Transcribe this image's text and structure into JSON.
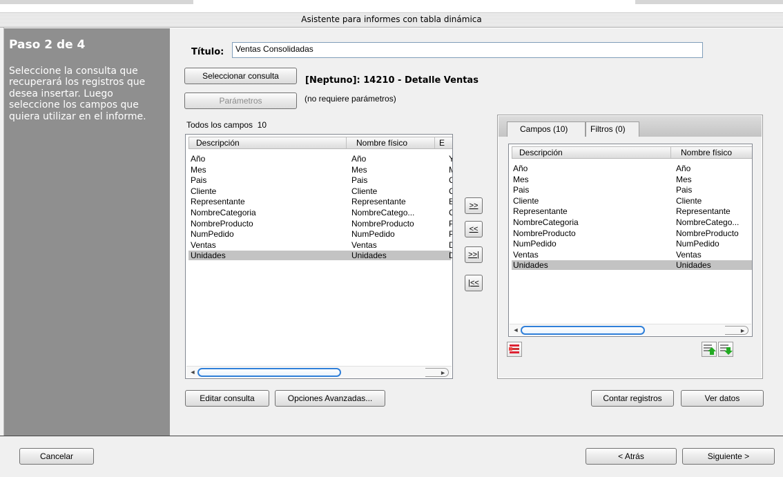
{
  "window": {
    "title": "Asistente para informes con tabla dinámica"
  },
  "sidebar": {
    "step": "Paso 2 de 4",
    "description": "Seleccione la consulta que recuperará los registros que desea insertar. Luego seleccione los campos que quiera utilizar en el informe."
  },
  "form": {
    "title_label": "Título:",
    "title_value": "Ventas Consolidadas",
    "select_query_label": "Seleccionar consulta",
    "query_name": "[Neptuno]: 14210 - Detalle Ventas",
    "parameters_label": "Parámetros",
    "parameters_note": "(no requiere parámetros)"
  },
  "all_fields": {
    "caption": "Todos los campos",
    "count": "10",
    "columns": [
      "Descripción",
      "Nombre físico",
      "E"
    ],
    "rows": [
      [
        "Año",
        "Año",
        "Y"
      ],
      [
        "Mes",
        "Mes",
        "M"
      ],
      [
        "Pais",
        "Pais",
        "C"
      ],
      [
        "Cliente",
        "Cliente",
        "C"
      ],
      [
        "Representante",
        "Representante",
        "E"
      ],
      [
        "NombreCategoria",
        "NombreCatego...",
        "C"
      ],
      [
        "NombreProducto",
        "NombreProducto",
        "P"
      ],
      [
        "NumPedido",
        "NumPedido",
        "P"
      ],
      [
        "Ventas",
        "Ventas",
        "D"
      ],
      [
        "Unidades",
        "Unidades",
        "D"
      ]
    ],
    "selected_index": 9
  },
  "move_buttons": [
    ">>",
    "<<",
    ">>|",
    "|<<"
  ],
  "tabs": [
    {
      "label": "Campos (10)",
      "active": true
    },
    {
      "label": "Filtros (0)",
      "active": false
    }
  ],
  "selected_fields": {
    "columns": [
      "Descripción",
      "Nombre físico"
    ],
    "rows": [
      [
        "Año",
        "Año"
      ],
      [
        "Mes",
        "Mes"
      ],
      [
        "Pais",
        "Pais"
      ],
      [
        "Cliente",
        "Cliente"
      ],
      [
        "Representante",
        "Representante"
      ],
      [
        "NombreCategoria",
        "NombreCatego..."
      ],
      [
        "NombreProducto",
        "NombreProducto"
      ],
      [
        "NumPedido",
        "NumPedido"
      ],
      [
        "Ventas",
        "Ventas"
      ],
      [
        "Unidades",
        "Unidades"
      ]
    ],
    "selected_index": 9
  },
  "buttons": {
    "edit_query": "Editar consulta",
    "advanced_options": "Opciones Avanzadas...",
    "count_records": "Contar registros",
    "view_data": "Ver datos",
    "cancel": "Cancelar",
    "back": "< Atrás",
    "next": "Siguiente >"
  }
}
